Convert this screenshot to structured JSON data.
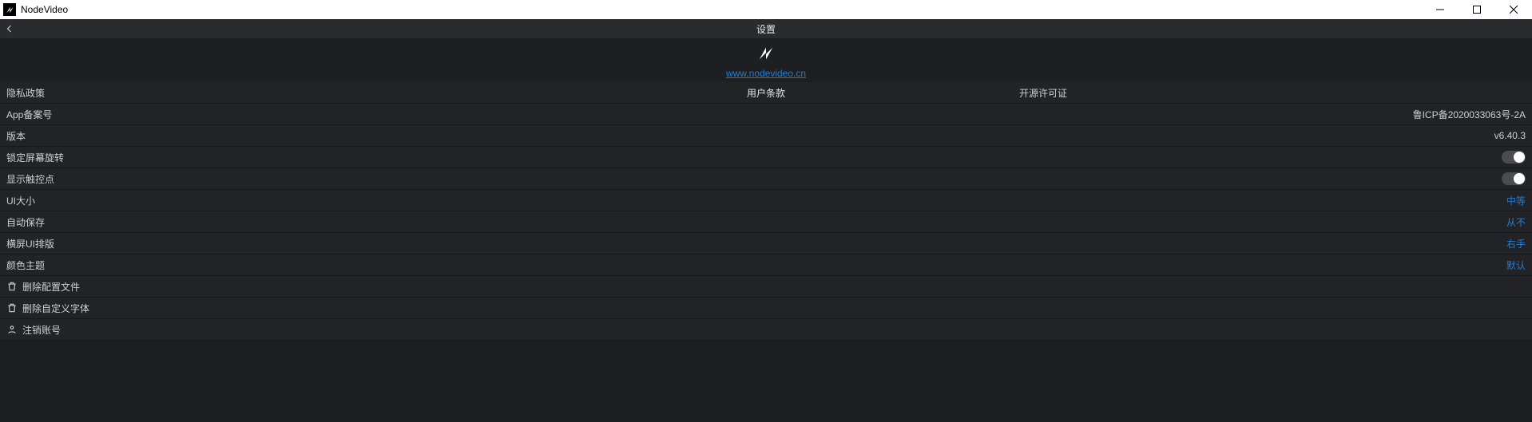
{
  "window": {
    "title": "NodeVideo"
  },
  "header": {
    "title": "设置"
  },
  "logo": {
    "url_label": "www.nodevideo.cn"
  },
  "triple_row": {
    "left": "隐私政策",
    "center": "用户条款",
    "right": "开源许可证"
  },
  "rows": {
    "record_number": {
      "label": "App备案号",
      "value": "鲁ICP备2020033063号-2A"
    },
    "version": {
      "label": "版本",
      "value": "v6.40.3"
    },
    "lock_rotation": {
      "label": "锁定屏幕旋转"
    },
    "show_touch": {
      "label": "显示触控点"
    },
    "ui_size": {
      "label": "UI大小",
      "value": "中等"
    },
    "auto_save": {
      "label": "自动保存",
      "value": "从不"
    },
    "landscape_ui": {
      "label": "横屏UI排版",
      "value": "右手"
    },
    "theme": {
      "label": "颜色主题",
      "value": "默认"
    },
    "delete_config": {
      "label": "删除配置文件"
    },
    "delete_fonts": {
      "label": "删除自定义字体"
    },
    "logout": {
      "label": "注销账号"
    }
  }
}
